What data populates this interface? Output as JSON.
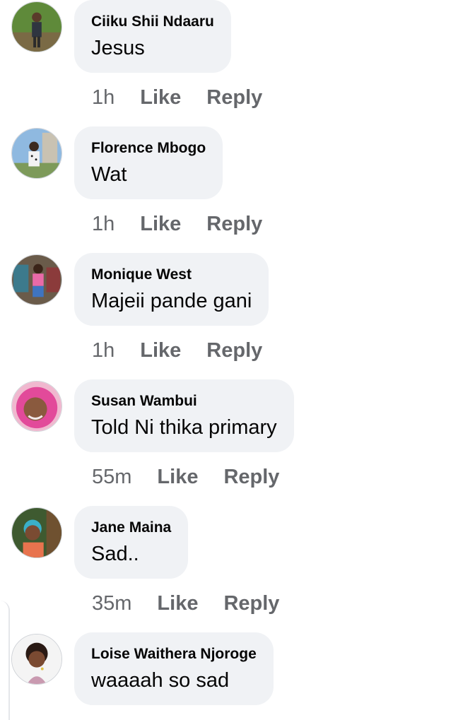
{
  "comments": [
    {
      "author": "Ciiku Shii Ndaaru",
      "text": "Jesus",
      "time": "1h",
      "like": "Like",
      "reply": "Reply"
    },
    {
      "author": "Florence Mbogo",
      "text": "Wat",
      "time": "1h",
      "like": "Like",
      "reply": "Reply"
    },
    {
      "author": "Monique West",
      "text": "Majeii pande gani",
      "time": "1h",
      "like": "Like",
      "reply": "Reply"
    },
    {
      "author": "Susan Wambui",
      "text": "Told Ni thika primary",
      "time": "55m",
      "like": "Like",
      "reply": "Reply"
    },
    {
      "author": "Jane Maina",
      "text": "Sad..",
      "time": "35m",
      "like": "Like",
      "reply": "Reply"
    },
    {
      "author": "Loise Waithera Njoroge",
      "text": "waaaah so sad",
      "time": "",
      "like": "",
      "reply": ""
    }
  ],
  "colors": {
    "bubble": "#f0f2f5",
    "meta": "#65676b",
    "text": "#050505"
  }
}
